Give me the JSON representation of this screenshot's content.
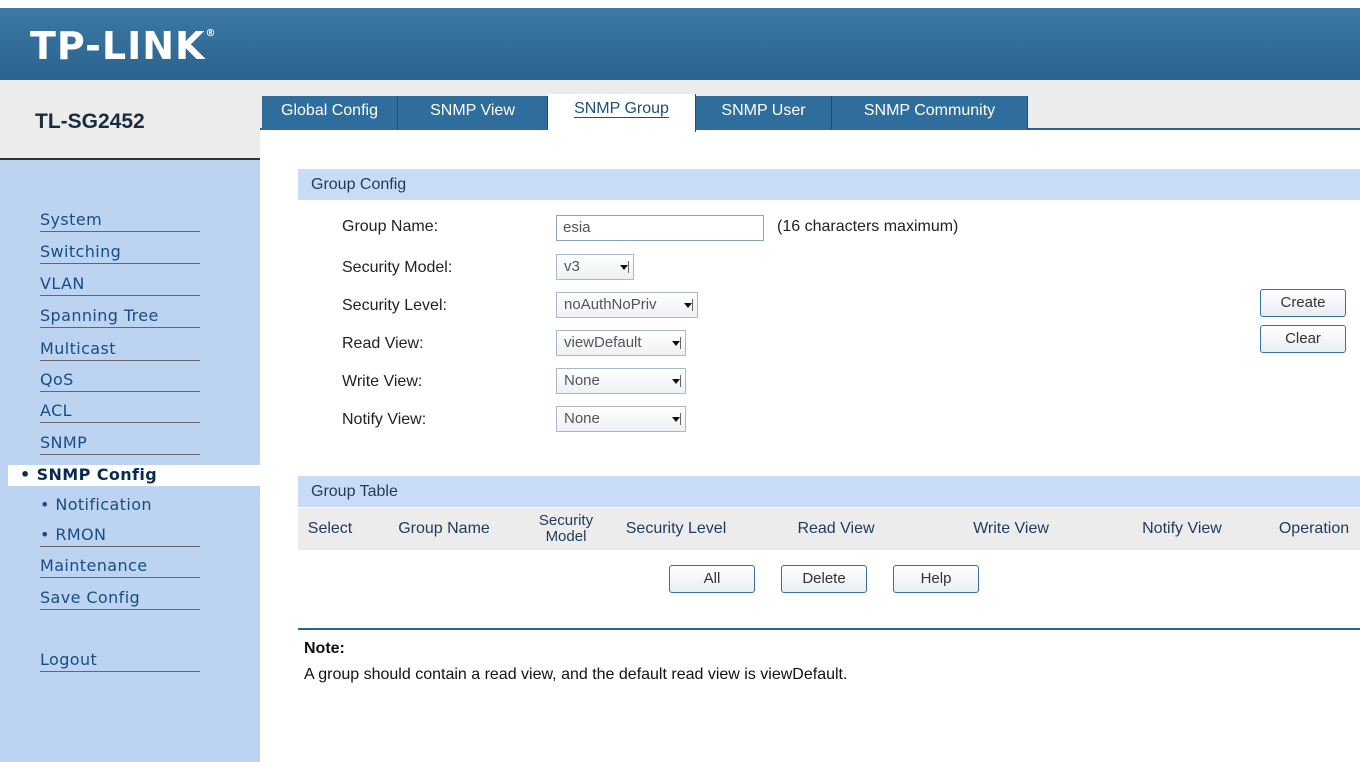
{
  "header": {
    "logo": "TP-LINK",
    "logo_mark": "®"
  },
  "sidebar": {
    "model": "TL-SG2452",
    "items": [
      {
        "label": "System"
      },
      {
        "label": "Switching"
      },
      {
        "label": "VLAN"
      },
      {
        "label": "Spanning Tree"
      },
      {
        "label": "Multicast"
      },
      {
        "label": "QoS"
      },
      {
        "label": "ACL"
      },
      {
        "label": "SNMP"
      },
      {
        "label": "• SNMP Config"
      },
      {
        "label": "• Notification"
      },
      {
        "label": "• RMON"
      },
      {
        "label": "Maintenance"
      },
      {
        "label": "Save Config"
      },
      {
        "label": "Logout"
      }
    ]
  },
  "tabs": [
    {
      "label": "Global Config"
    },
    {
      "label": "SNMP View"
    },
    {
      "label": "SNMP Group"
    },
    {
      "label": "SNMP User"
    },
    {
      "label": "SNMP Community"
    }
  ],
  "group_config": {
    "title": "Group Config",
    "group_name_label": "Group Name:",
    "group_name_value": "esia",
    "group_name_hint": "(16 characters maximum)",
    "security_model_label": "Security Model:",
    "security_model_value": "v3",
    "security_level_label": "Security Level:",
    "security_level_value": "noAuthNoPriv",
    "read_view_label": "Read View:",
    "read_view_value": "viewDefault",
    "write_view_label": "Write View:",
    "write_view_value": "None",
    "notify_view_label": "Notify View:",
    "notify_view_value": "None",
    "create_label": "Create",
    "clear_label": "Clear"
  },
  "group_table": {
    "title": "Group Table",
    "columns": [
      {
        "label": "Select"
      },
      {
        "label": "Group Name"
      },
      {
        "label": "Security Model"
      },
      {
        "label": "Security Level"
      },
      {
        "label": "Read View"
      },
      {
        "label": "Write View"
      },
      {
        "label": "Notify View"
      },
      {
        "label": "Operation"
      }
    ],
    "all_label": "All",
    "delete_label": "Delete",
    "help_label": "Help"
  },
  "note": {
    "title": "Note:",
    "text": "A group should contain a read view, and the default read view is viewDefault."
  }
}
